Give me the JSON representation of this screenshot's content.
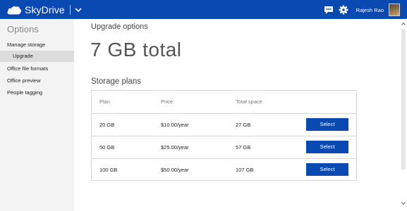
{
  "topbar": {
    "brand": "SkyDrive",
    "user_name": "Rajesh Rao",
    "bg_color": "#094ab2",
    "icons": [
      "cloud-logo-icon",
      "chevron-down-icon",
      "messenger-icon",
      "gear-icon"
    ]
  },
  "sidebar": {
    "title": "Options",
    "items": [
      {
        "label": "Manage storage"
      },
      {
        "label": "Upgrade",
        "selected": true
      },
      {
        "label": "Office file formats"
      },
      {
        "label": "Office preview"
      },
      {
        "label": "People tagging"
      }
    ]
  },
  "main": {
    "title": "Upgrade options",
    "total": "7 GB total",
    "plans_title": "Storage plans",
    "columns": [
      "Plan",
      "Price",
      "Total space"
    ],
    "plans": [
      {
        "plan": "20 GB",
        "price": "$10.00/year",
        "total": "27 GB",
        "action": "Select"
      },
      {
        "plan": "50 GB",
        "price": "$25.00/year",
        "total": "57 GB",
        "action": "Select"
      },
      {
        "plan": "100 GB",
        "price": "$50.00/year",
        "total": "107 GB",
        "action": "Select"
      }
    ],
    "accent_color": "#094ab2"
  }
}
